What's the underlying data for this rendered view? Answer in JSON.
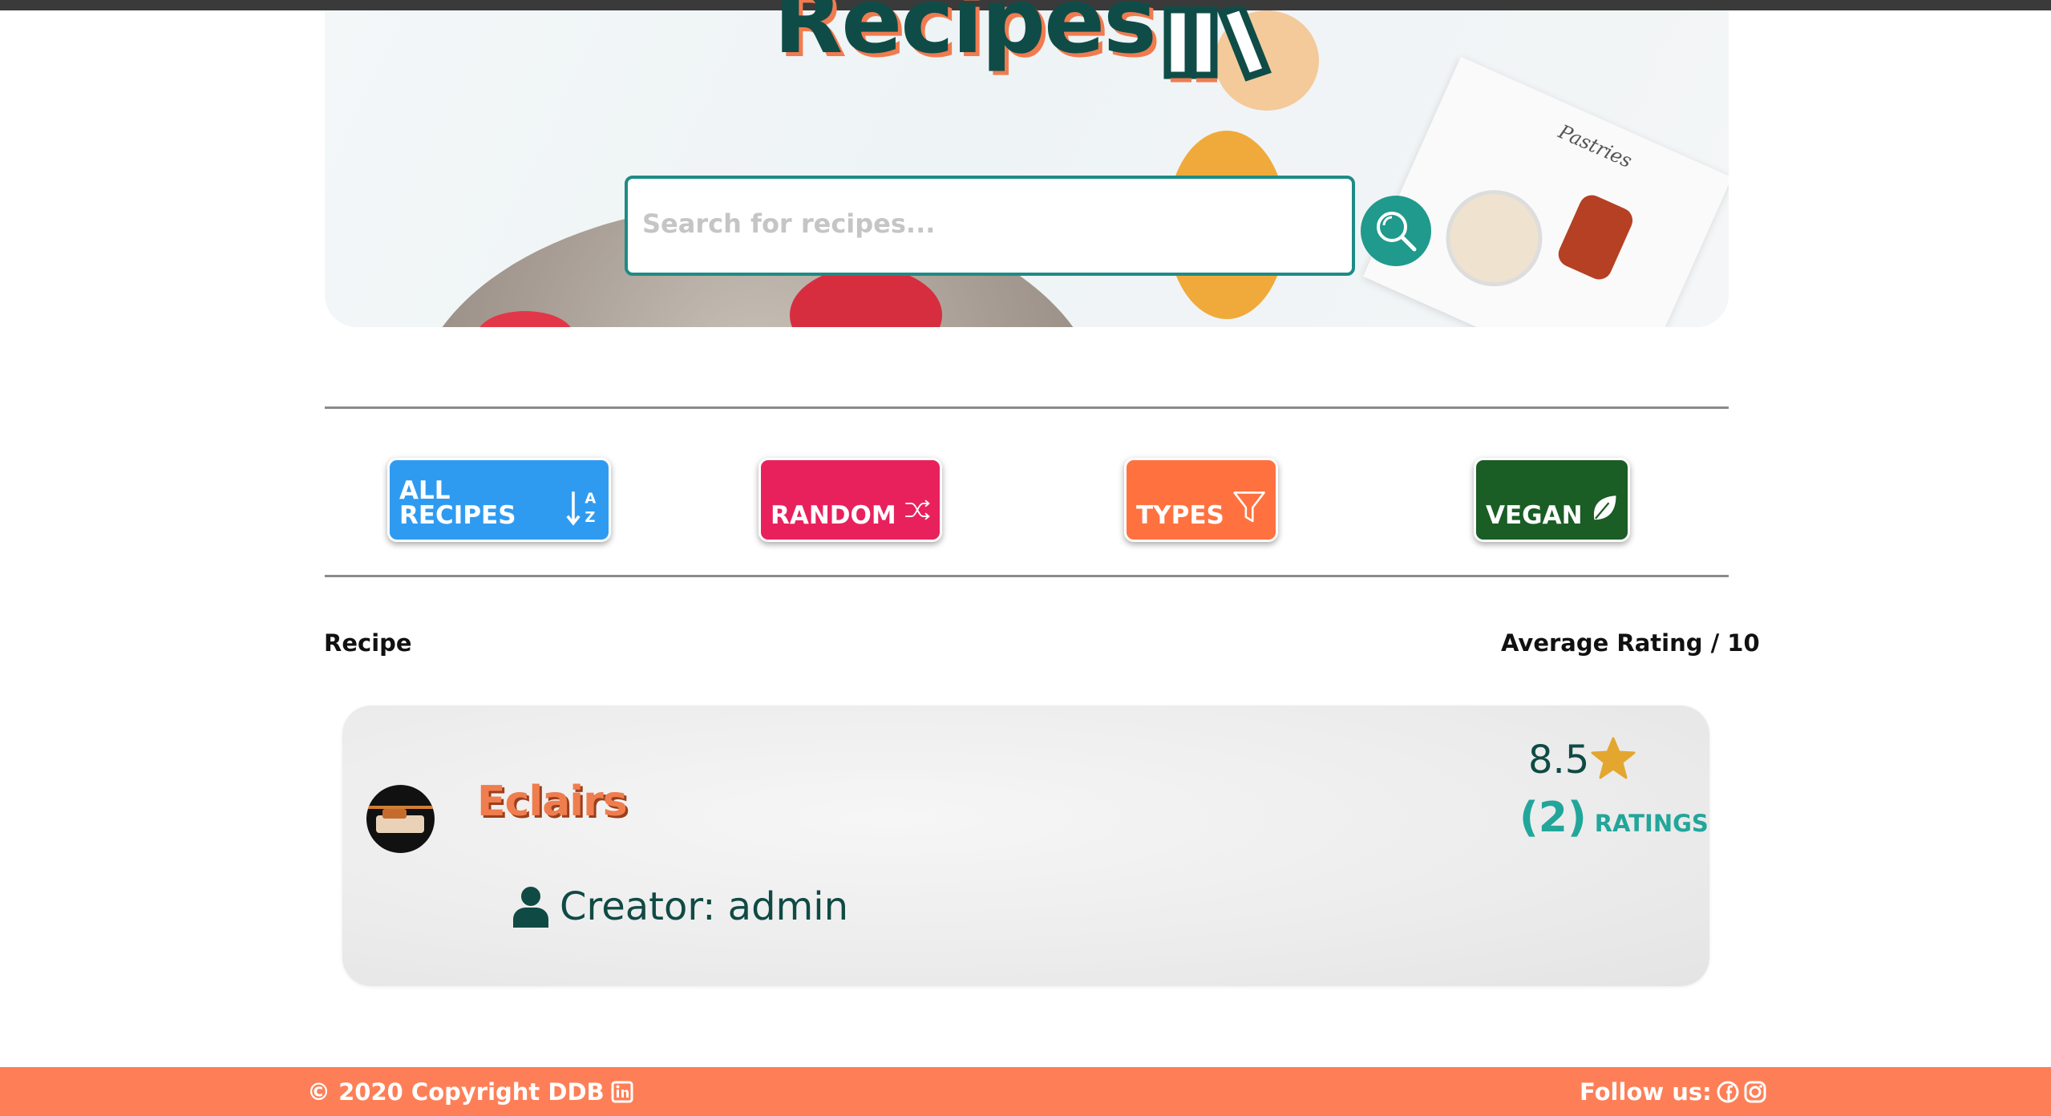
{
  "header": {
    "title": "Recipes",
    "title_icon": "utensils-books-icon"
  },
  "search": {
    "placeholder": "Search for recipes...",
    "value": "",
    "button_icon": "search-icon"
  },
  "filters": [
    {
      "label": "ALL RECIPES",
      "icon": "sort-alpha-down-icon",
      "color": "#2f9bf0"
    },
    {
      "label": "RANDOM",
      "icon": "shuffle-icon",
      "color": "#e8215d"
    },
    {
      "label": "TYPES",
      "icon": "filter-icon",
      "color": "#ff7240"
    },
    {
      "label": "VEGAN",
      "icon": "leaf-icon",
      "color": "#1a5d25"
    }
  ],
  "table": {
    "col_recipe": "Recipe",
    "col_rating": "Average Rating / 10"
  },
  "recipes": [
    {
      "name": "Eclairs",
      "creator": "Creator: admin",
      "rating": "8.5",
      "ratings_count": "(2)",
      "ratings_label": "RATINGS"
    }
  ],
  "footer": {
    "copyright": "© 2020 Copyright DDB",
    "follow": "Follow us:"
  },
  "colors": {
    "accent_teal": "#1e8b85",
    "title_green": "#0f4c47",
    "footer_orange": "#fe7f57",
    "star_gold": "#e3a72f"
  }
}
